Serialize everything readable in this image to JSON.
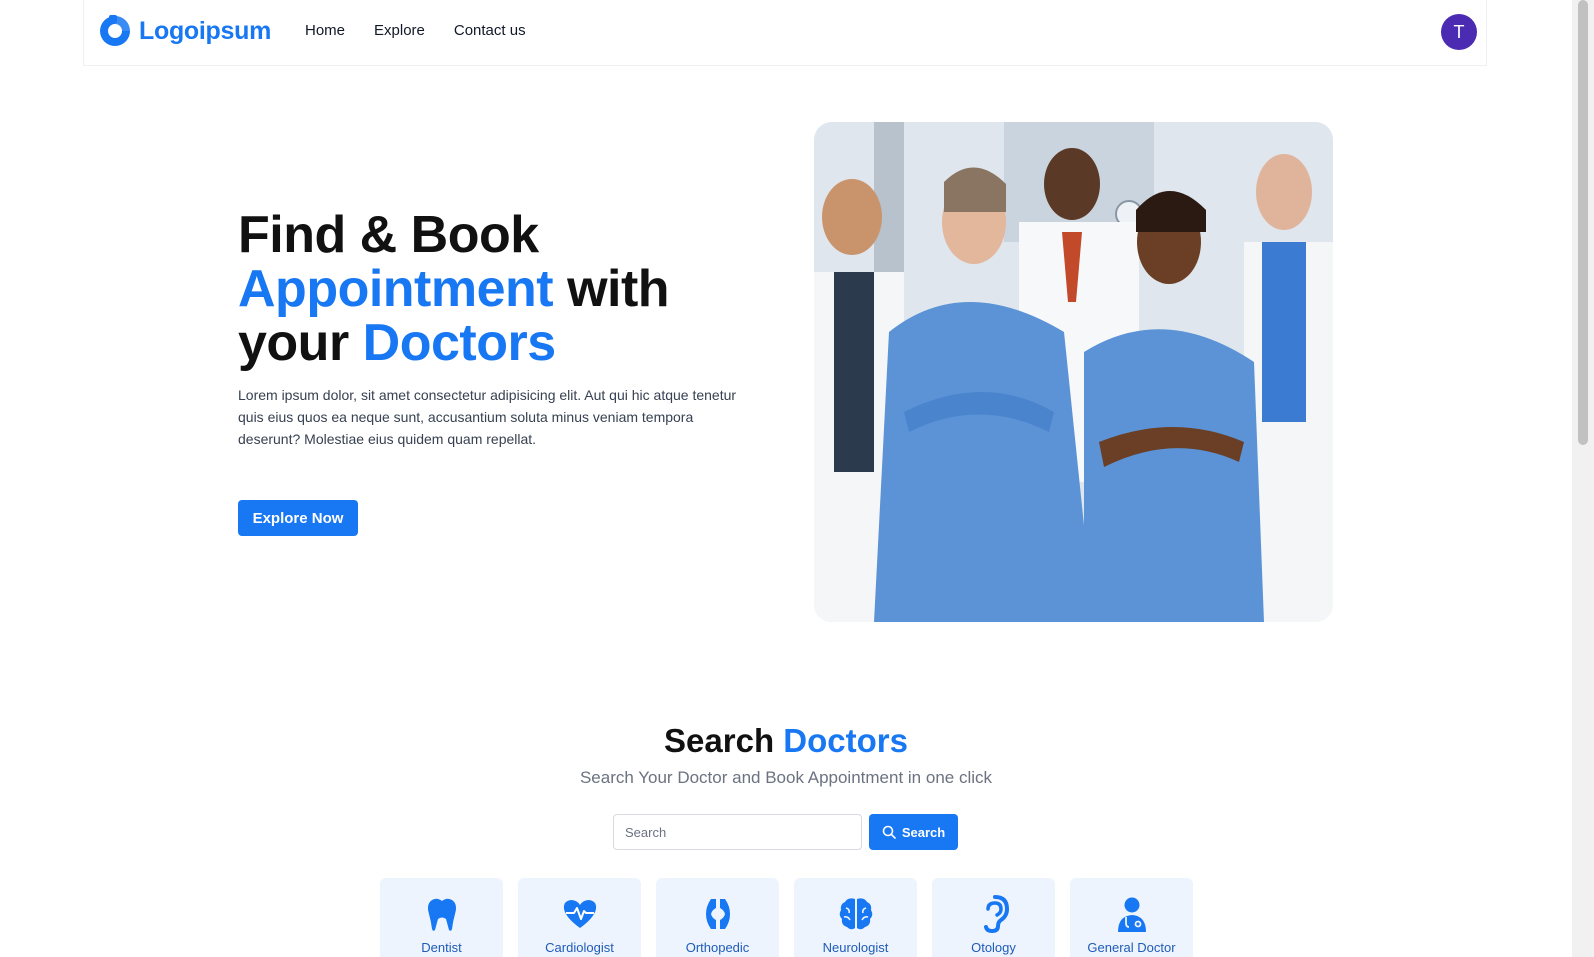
{
  "brand": {
    "name": "Logoipsum",
    "color": "#1877f2"
  },
  "nav": {
    "items": [
      {
        "label": "Home"
      },
      {
        "label": "Explore"
      },
      {
        "label": "Contact us"
      }
    ]
  },
  "user": {
    "initial": "T",
    "avatar_color": "#4c2bb3"
  },
  "hero": {
    "title_part1": "Find & Book",
    "title_accent1": "Appointment",
    "title_part2": "with",
    "title_part3": "your",
    "title_accent2": "Doctors",
    "description": "Lorem ipsum dolor, sit amet consectetur adipisicing elit. Aut qui hic atque tenetur quis eius quos ea neque sunt, accusantium soluta minus veniam tempora deserunt? Molestiae eius quidem quam repellat.",
    "cta_label": "Explore Now"
  },
  "search": {
    "title_part": "Search",
    "title_accent": "Doctors",
    "subtitle": "Search Your Doctor and Book Appointment in one click",
    "placeholder": "Search",
    "button_label": "Search"
  },
  "categories": [
    {
      "label": "Dentist",
      "icon": "tooth-icon"
    },
    {
      "label": "Cardiologist",
      "icon": "heartbeat-icon"
    },
    {
      "label": "Orthopedic",
      "icon": "bone-joint-icon"
    },
    {
      "label": "Neurologist",
      "icon": "brain-icon"
    },
    {
      "label": "Otology",
      "icon": "ear-icon"
    },
    {
      "label": "General Doctor",
      "icon": "doctor-icon"
    }
  ]
}
